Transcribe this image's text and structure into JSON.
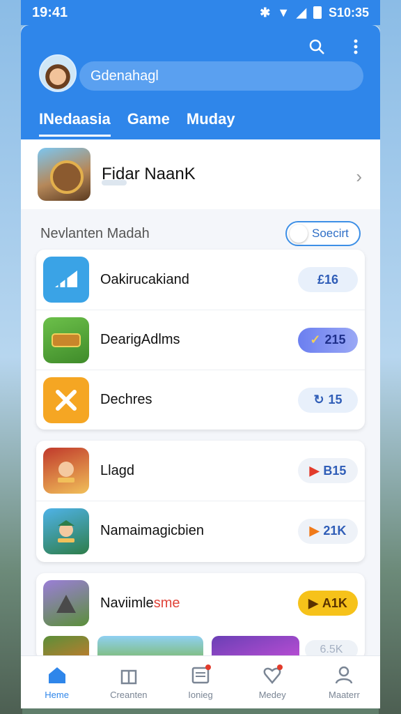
{
  "status": {
    "time": "19:41",
    "right_text": "S10:35"
  },
  "header": {
    "search_text": "Gdenahagl",
    "tabs": [
      {
        "label": "INedaasia",
        "active": true
      },
      {
        "label": "Game",
        "active": false
      },
      {
        "label": "Muday",
        "active": false
      }
    ]
  },
  "featured": {
    "title": "Fidar NaanK"
  },
  "section": {
    "title": "Nevlanten Madah",
    "toggle_label": "Soecirt"
  },
  "list_primary": [
    {
      "title": "Oakirucakiand",
      "badge": "£16",
      "badge_icon": "",
      "icon_name": "chart-app-icon",
      "icon_color": "#3aa3e6"
    },
    {
      "title": "DearigAdlms",
      "badge": "215",
      "badge_icon": "✓",
      "icon_name": "game-app-icon",
      "icon_color": "#55a83b"
    },
    {
      "title": "Dechres",
      "badge": "15",
      "badge_icon": "↻",
      "icon_name": "close-app-icon",
      "icon_color": "#f5a623"
    }
  ],
  "list_secondary": [
    {
      "title": "Llagd",
      "badge": "B15",
      "badge_icon": "▶",
      "icon_name": "hero-app-icon"
    },
    {
      "title": "Namaimagicbien",
      "badge": "21K",
      "badge_icon": "▶",
      "icon_name": "adventure-app-icon"
    }
  ],
  "list_third": {
    "title_main": "Naviimle",
    "title_accent": "sme",
    "badge": "A1K",
    "badge_faint": "6.5K"
  },
  "nav": [
    {
      "label": "Heme",
      "active": true
    },
    {
      "label": "Creanten",
      "active": false
    },
    {
      "label": "Ionieg",
      "active": false
    },
    {
      "label": "Medey",
      "active": false
    },
    {
      "label": "Maaterr",
      "active": false
    }
  ]
}
